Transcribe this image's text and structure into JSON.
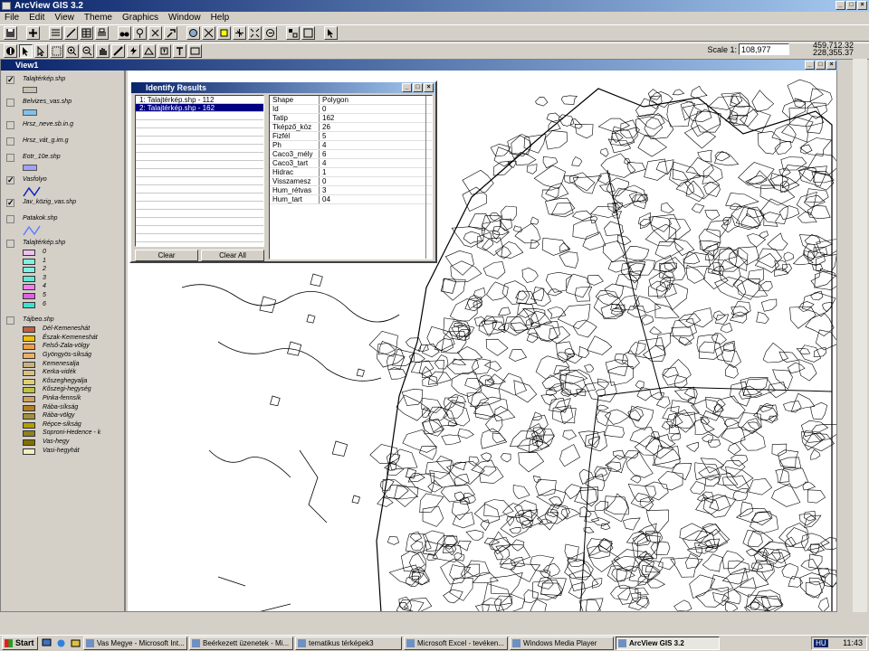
{
  "app": {
    "title": "ArcView GIS 3.2"
  },
  "menu": [
    "File",
    "Edit",
    "View",
    "Theme",
    "Graphics",
    "Window",
    "Help"
  ],
  "scale": {
    "label": "Scale 1:",
    "value": "108,977"
  },
  "coordinates": {
    "x": "459,712.32",
    "y": "228,355.37"
  },
  "view": {
    "title": "View1"
  },
  "themes": [
    {
      "name": "Talajtérkép.shp",
      "checked": true,
      "swatch": "#c8c0b0",
      "swatch_kind": "fill"
    },
    {
      "name": "Belvizes_vas.shp",
      "checked": false,
      "swatch": "#80c0e8",
      "swatch_kind": "fill"
    },
    {
      "name": "Hrsz_neve.sb.in.g",
      "checked": false
    },
    {
      "name": "Hrsz_vát_g.im.g",
      "checked": false
    },
    {
      "name": "Eotr_10e.shp",
      "checked": false,
      "swatch": "#a0a0ff",
      "swatch_kind": "fill"
    },
    {
      "name": "Vasfolyo",
      "checked": true,
      "swatch": "#1020c0",
      "swatch_kind": "line"
    },
    {
      "name": "Jav_közig_vas.shp",
      "checked": true
    },
    {
      "name": "Patakok.shp",
      "checked": false,
      "swatch": "#6080ff",
      "swatch_kind": "line"
    }
  ],
  "soil_theme": {
    "name": "Talajtérkép.shp",
    "classes": [
      {
        "label": "0",
        "color": "#f0c0f0"
      },
      {
        "label": "1",
        "color": "#80f0e0"
      },
      {
        "label": "2",
        "color": "#80f0e0"
      },
      {
        "label": "3",
        "color": "#60e8d0"
      },
      {
        "label": "4",
        "color": "#f080f0"
      },
      {
        "label": "5",
        "color": "#e060e0"
      },
      {
        "label": "6",
        "color": "#40e0d0"
      }
    ]
  },
  "landscape_theme": {
    "name": "Tájbeo.shp",
    "classes": [
      {
        "label": "Dél-Kemeneshát",
        "color": "#c06040"
      },
      {
        "label": "Észak-Kemeneshát",
        "color": "#f0c000"
      },
      {
        "label": "Felső-Zala-völgy",
        "color": "#f0a040"
      },
      {
        "label": "Gyöngyös-síkság",
        "color": "#f0b060"
      },
      {
        "label": "Kemenesalja",
        "color": "#c8b080"
      },
      {
        "label": "Kerka-vidék",
        "color": "#d8c080"
      },
      {
        "label": "Kőszeghegyalja",
        "color": "#e0d070"
      },
      {
        "label": "Kőszegi-hegység",
        "color": "#c0c040"
      },
      {
        "label": "Pinka-fennsík",
        "color": "#d0a060"
      },
      {
        "label": "Rába-síkság",
        "color": "#b08020"
      },
      {
        "label": "Rába-völgy",
        "color": "#a09040"
      },
      {
        "label": "Répce-síkság",
        "color": "#b0a000"
      },
      {
        "label": "Soproni-Hedence - k",
        "color": "#908020"
      },
      {
        "label": "Vas-hegy",
        "color": "#807000"
      },
      {
        "label": "Vasi-hegyhát",
        "color": "#f0f0c0"
      }
    ]
  },
  "identify": {
    "title": "Identify Results",
    "results": [
      "1: Talajtérkép.shp - 112",
      "2: Talajtérkép.shp - 162"
    ],
    "selected_index": 1,
    "attributes": [
      [
        "Shape",
        "Polygon"
      ],
      [
        "Id",
        "0"
      ],
      [
        "Tatip",
        "162"
      ],
      [
        "Tképző_köz",
        "26"
      ],
      [
        "Fizfél",
        "5"
      ],
      [
        "Ph",
        "4"
      ],
      [
        "Caco3_mély",
        "6"
      ],
      [
        "Caco3_tart",
        "4"
      ],
      [
        "Hidrac",
        "1"
      ],
      [
        "Visszamesz",
        "0"
      ],
      [
        "Hum_rétvas",
        "3"
      ],
      [
        "Hum_tart",
        "04"
      ]
    ],
    "clear_label": "Clear",
    "clear_all_label": "Clear All"
  },
  "taskbar": {
    "start_label": "Start",
    "tasks": [
      {
        "label": "Vas Megye - Microsoft Int...",
        "active": false
      },
      {
        "label": "Beérkezett üzenetek - Mi...",
        "active": false
      },
      {
        "label": "tematikus térképek3",
        "active": false
      },
      {
        "label": "Microsoft Excel - tevéken...",
        "active": false
      },
      {
        "label": "Windows Media Player",
        "active": false
      },
      {
        "label": "ArcView GIS 3.2",
        "active": true
      }
    ],
    "tray_lang": "HU",
    "clock": "11:43"
  }
}
